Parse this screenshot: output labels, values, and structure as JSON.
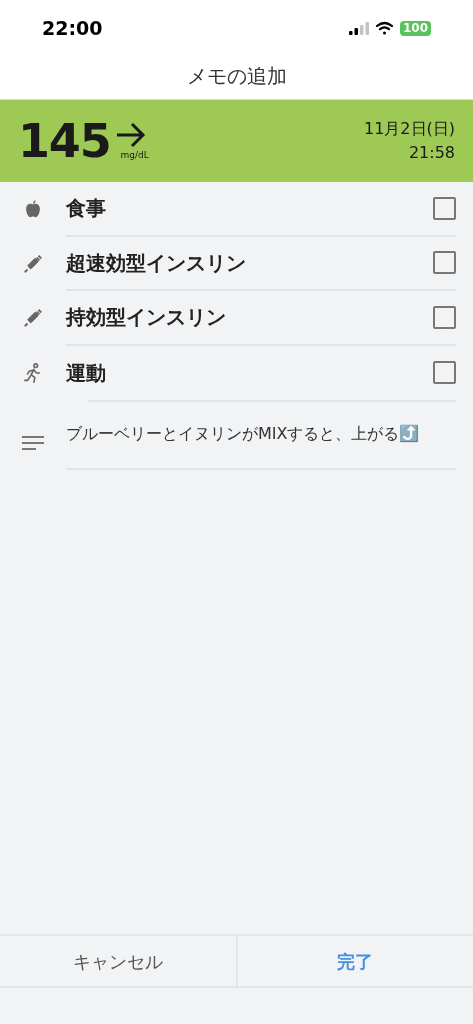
{
  "status_bar": {
    "time": "22:00",
    "battery": "100"
  },
  "title": "メモの追加",
  "reading": {
    "value": "145",
    "unit": "mg/dL",
    "date": "11月2日(日)",
    "time": "21:58"
  },
  "items": [
    {
      "kind": "food",
      "label": "食事",
      "checked": false
    },
    {
      "kind": "insulin",
      "label": "超速効型インスリン",
      "checked": false
    },
    {
      "kind": "insulin",
      "label": "持効型インスリン",
      "checked": false
    },
    {
      "kind": "exercise",
      "label": "運動",
      "checked": false
    }
  ],
  "memo": {
    "value": "ブルーベリーとイヌリンがMIXすると、上がる⤴️"
  },
  "buttons": {
    "cancel": "キャンセル",
    "done": "完了"
  }
}
